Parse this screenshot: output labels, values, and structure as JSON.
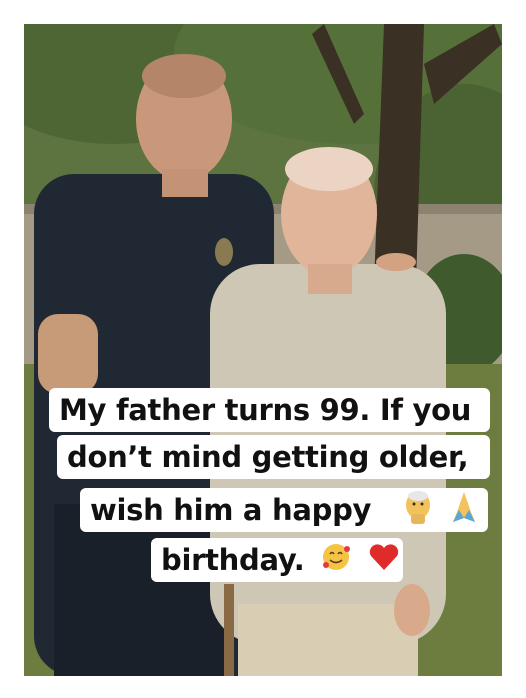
{
  "caption": {
    "line1": "My father turns 99. If you",
    "line2": "don’t mind getting older,",
    "line3": "wish him a happy",
    "line4": "birthday."
  },
  "emojis": [
    "old-person-emoji",
    "praying-hands-emoji",
    "smiling-face-with-hearts-emoji",
    "red-heart-emoji"
  ],
  "colors": {
    "caption_bg": "#ffffff",
    "caption_text": "#111111",
    "uniform": "#1f2833",
    "shirt": "#cfc7b6",
    "foliage": "#4f6636"
  }
}
